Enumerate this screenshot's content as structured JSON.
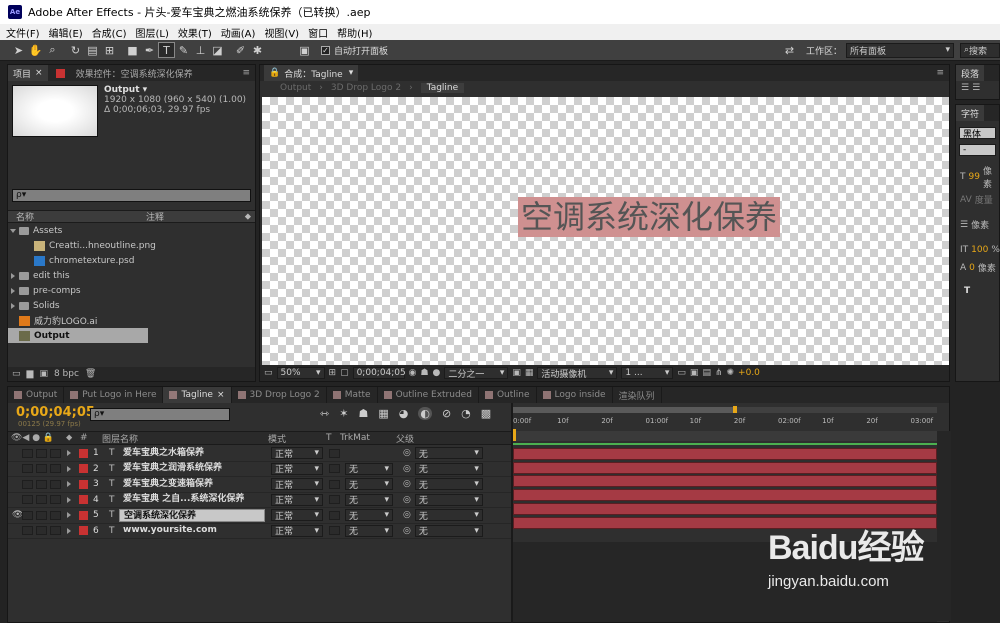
{
  "window": {
    "title": "Adobe After Effects - 片头-爱车宝典之燃油系统保养（已转换）.aep",
    "logo": "Ae"
  },
  "menu": [
    "文件(F)",
    "编辑(E)",
    "合成(C)",
    "图层(L)",
    "效果(T)",
    "动画(A)",
    "视图(V)",
    "窗口",
    "帮助(H)"
  ],
  "toolbar": {
    "auto_open": "自动打开面板",
    "workspace_label": "工作区：",
    "workspace_value": "所有面板",
    "search_placeholder": "搜索"
  },
  "project": {
    "tab_project": "项目",
    "tab_effects": "效果控件：空调系统深化保养",
    "comp_name": "Output ▾",
    "comp_size": "1920 x 1080  (960 x 540) (1.00)",
    "comp_dur": "Δ 0;00;06;03, 29.97 fps",
    "search": "ρ▾",
    "col_name": "名称",
    "col_comment": "注释",
    "items": [
      {
        "name": "Assets",
        "kind": "folder-open"
      },
      {
        "name": "Creatti...hneoutline.png",
        "kind": "png"
      },
      {
        "name": "chrometexture.psd",
        "kind": "psd"
      },
      {
        "name": "edit this",
        "kind": "folder"
      },
      {
        "name": "pre-comps",
        "kind": "folder"
      },
      {
        "name": "Solids",
        "kind": "folder"
      },
      {
        "name": "威力豹LOGO.ai",
        "kind": "ai"
      },
      {
        "name": "Output",
        "kind": "comp"
      }
    ],
    "bpc": "8 bpc"
  },
  "composition": {
    "tab": "合成：Tagline",
    "crumbs": [
      "Output",
      "3D Drop Logo 2",
      "Tagline"
    ],
    "title_text": "空调系统深化保养",
    "zoom": "50%",
    "timecode": "0;00;04;05",
    "resolution": "二分之一",
    "camera": "活动摄像机",
    "views": "1 ...",
    "exposure": "+0.0"
  },
  "right": {
    "tab_paragraph": "段落",
    "tab_char": "字符",
    "font": "黑体",
    "style": "-",
    "size": "99",
    "size_unit": "像素",
    "tracking": "度量",
    "leading_unit": "像素",
    "scale": "100",
    "scale_unit": "%",
    "baseline": "0",
    "baseline_unit": "像素",
    "t_icon": "T"
  },
  "timeline": {
    "tabs": [
      "Output",
      "Put Logo in Here",
      "Tagline",
      "3D Drop Logo 2",
      "Matte",
      "Outline Extruded",
      "Outline",
      "Logo inside",
      "渲染队列"
    ],
    "active_tab": 2,
    "timecode": "0;00;04;05",
    "frame_info": "00125 (29.97 fps)",
    "search": "ρ▾",
    "col_num": "#",
    "col_name": "图层名称",
    "col_mode": "模式",
    "col_t": "T",
    "col_trkmat": "TrkMat",
    "col_parent": "父级",
    "ruler": [
      "0:00f",
      "10f",
      "20f",
      "01:00f",
      "10f",
      "20f",
      "02:00f",
      "10f",
      "20f",
      "03:00f"
    ],
    "layers": [
      {
        "num": "1",
        "name": "爱车宝典之水箱保养",
        "mode": "正常",
        "trkmat": "",
        "parent": "无"
      },
      {
        "num": "2",
        "name": "爱车宝典之润滑系统保养",
        "mode": "正常",
        "trkmat": "无",
        "parent": "无"
      },
      {
        "num": "3",
        "name": "爱车宝典之变速箱保养",
        "mode": "正常",
        "trkmat": "无",
        "parent": "无"
      },
      {
        "num": "4",
        "name": "爱车宝典 之自...系统深化保养",
        "mode": "正常",
        "trkmat": "无",
        "parent": "无"
      },
      {
        "num": "5",
        "name": "空调系统深化保养",
        "mode": "正常",
        "trkmat": "无",
        "parent": "无"
      },
      {
        "num": "6",
        "name": "www.yoursite.com",
        "mode": "正常",
        "trkmat": "无",
        "parent": "无"
      }
    ]
  },
  "watermark": {
    "brand": "Baidu经验",
    "url": "jingyan.baidu.com"
  },
  "colors": {
    "accent": "#e8a818",
    "label_red": "#c83232",
    "bar": "#a53a44",
    "text_highlight": "#cf9090"
  }
}
